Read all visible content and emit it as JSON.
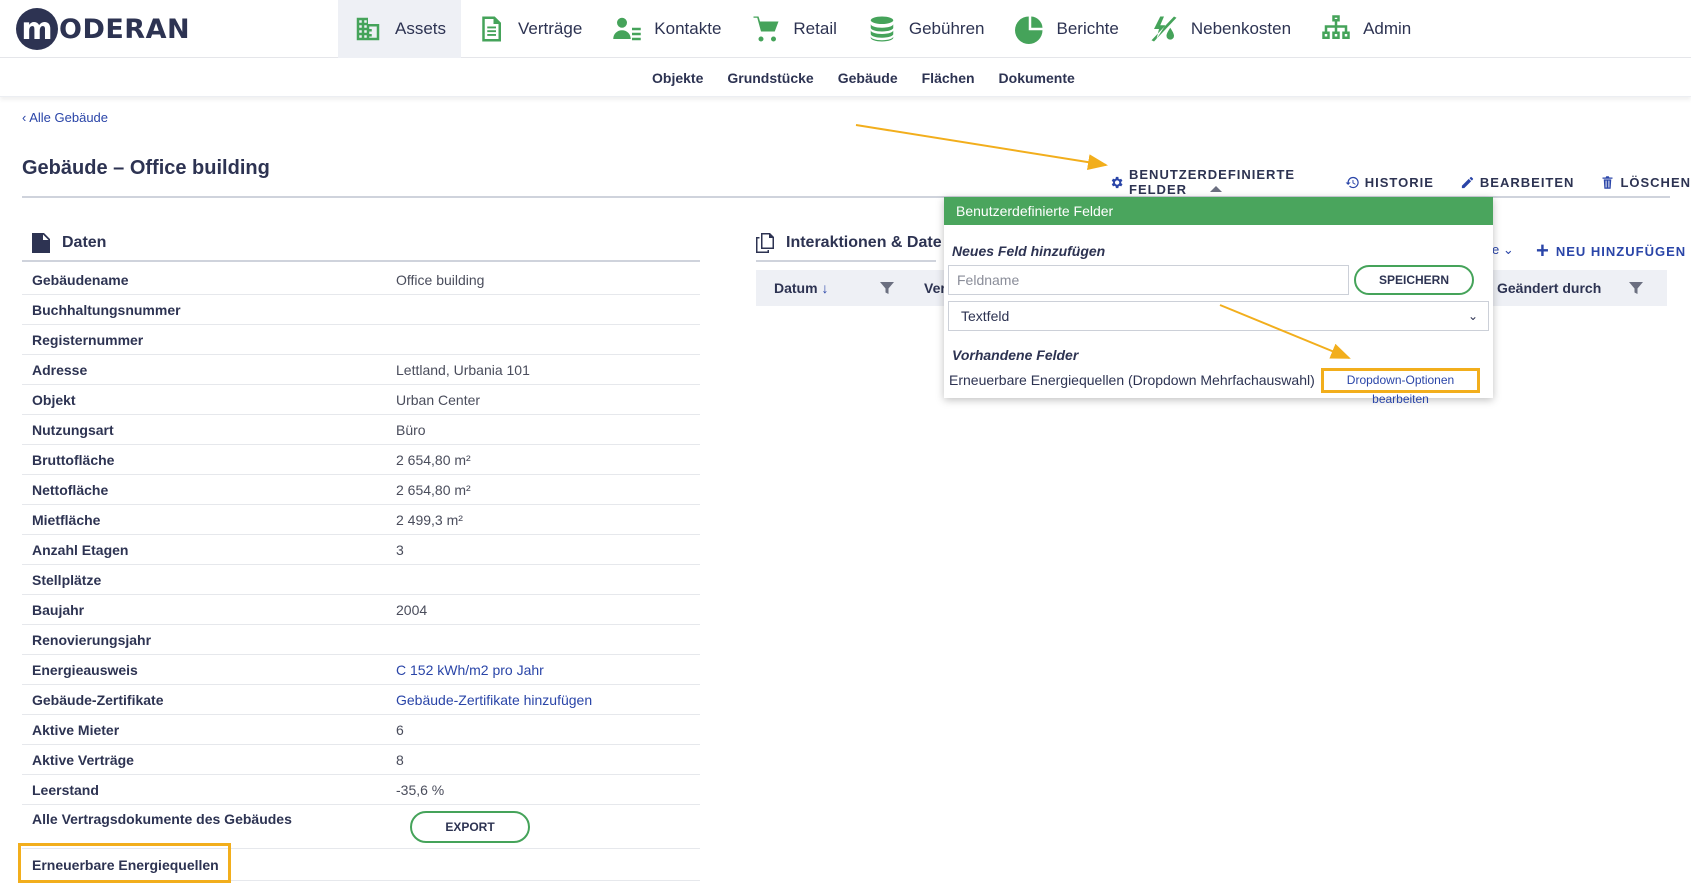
{
  "logo": {
    "letter": "m",
    "text": "ODERAN"
  },
  "main_nav": [
    {
      "label": "Assets",
      "icon": "building-icon",
      "active": true
    },
    {
      "label": "Verträge",
      "icon": "document-icon"
    },
    {
      "label": "Kontakte",
      "icon": "contacts-icon"
    },
    {
      "label": "Retail",
      "icon": "cart-icon"
    },
    {
      "label": "Gebühren",
      "icon": "coins-icon"
    },
    {
      "label": "Berichte",
      "icon": "pie-chart-icon"
    },
    {
      "label": "Nebenkosten",
      "icon": "utilities-icon"
    },
    {
      "label": "Admin",
      "icon": "org-chart-icon"
    }
  ],
  "sub_nav": [
    "Objekte",
    "Grundstücke",
    "Gebäude",
    "Flächen",
    "Dokumente"
  ],
  "back_link": "‹ Alle Gebäude",
  "page_title": "Gebäude – Office building",
  "actions": {
    "custom_fields": "BENUTZERDEFINIERTE FELDER",
    "history": "HISTORIE",
    "edit": "BEARBEITEN",
    "delete": "LÖSCHEN"
  },
  "daten": {
    "title": "Daten",
    "rows": [
      {
        "label": "Gebäudename",
        "value": "Office building"
      },
      {
        "label": "Buchhaltungsnummer",
        "value": ""
      },
      {
        "label": "Registernummer",
        "value": ""
      },
      {
        "label": "Adresse",
        "value": "Lettland, Urbania 101"
      },
      {
        "label": "Objekt",
        "value": "Urban Center"
      },
      {
        "label": "Nutzungsart",
        "value": "Büro"
      },
      {
        "label": "Bruttofläche",
        "value": "2 654,80 m²"
      },
      {
        "label": "Nettofläche",
        "value": "2 654,80 m²"
      },
      {
        "label": "Mietfläche",
        "value": "2 499,3 m²"
      },
      {
        "label": "Anzahl Etagen",
        "value": "3"
      },
      {
        "label": "Stellplätze",
        "value": ""
      },
      {
        "label": "Baujahr",
        "value": "2004"
      },
      {
        "label": "Renovierungsjahr",
        "value": ""
      },
      {
        "label": "Energieausweis",
        "value": "C 152 kWh/m2 pro Jahr"
      },
      {
        "label": "Gebäude-Zertifikate",
        "value": "Gebäude-Zertifikate hinzufügen"
      },
      {
        "label": "Aktive Mieter",
        "value": "6"
      },
      {
        "label": "Aktive Verträge",
        "value": "8"
      },
      {
        "label": "Leerstand",
        "value": "-35,6 %"
      }
    ],
    "export_label": "Alle Vertragsdokumente des Gebäudes",
    "export_button": "EXPORT",
    "custom_field_label": "Erneuerbare Energiequellen"
  },
  "interaktionen": {
    "title": "Interaktionen & Date",
    "partial_dropdown": "e ⌄",
    "add_new": "NEU HINZUFÜGEN",
    "columns": {
      "date": "Datum",
      "partial": "Ver",
      "changed_by": "Geändert durch"
    }
  },
  "popup": {
    "header": "Benutzerdefinierte Felder",
    "new_field_title": "Neues Feld hinzufügen",
    "field_name_placeholder": "Feldname",
    "save_button": "SPEICHERN",
    "field_type": "Textfeld",
    "existing_title": "Vorhandene Felder",
    "existing_field": "Erneuerbare Energiequellen (Dropdown Mehrfachauswahl)",
    "edit_options_link": "Dropdown-Optionen bearbeiten"
  },
  "colors": {
    "accent_green": "#45a35a",
    "link_blue": "#2a45a8",
    "highlight": "#f2ae1c",
    "navy": "#2d3352"
  }
}
